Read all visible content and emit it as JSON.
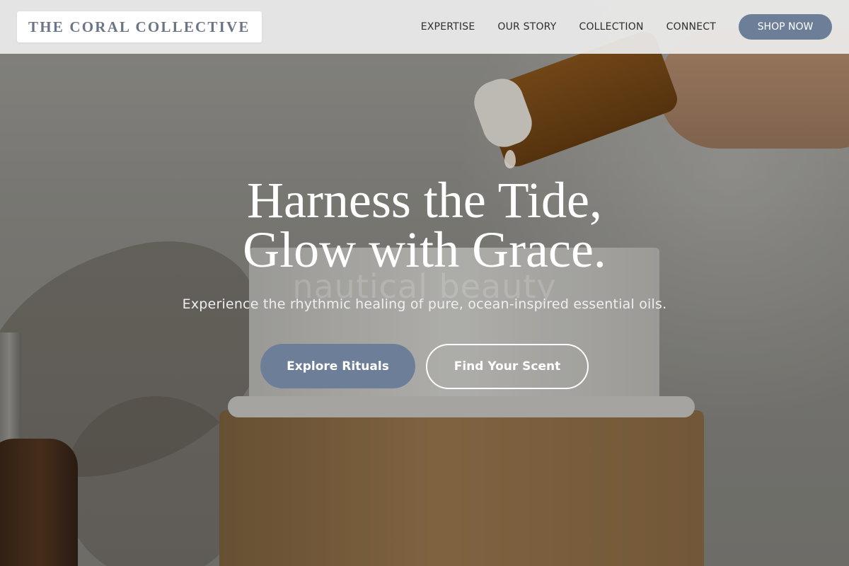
{
  "header": {
    "logo": "THE CORAL COLLECTIVE",
    "nav": [
      "EXPERTISE",
      "OUR STORY",
      "COLLECTION",
      "CONNECT"
    ],
    "cta": "SHOP NOW"
  },
  "hero": {
    "headline_line1": "Harness the Tide,",
    "headline_line2": "Glow with Grace.",
    "ghost_text": "nautical beauty",
    "subtitle": "Experience the rhythmic healing of pure, ocean-inspired essential oils.",
    "primary_button": "Explore Rituals",
    "secondary_button": "Find Your Scent"
  },
  "colors": {
    "accent": "#6d7f98",
    "header_bg": "#ececec",
    "logo_text": "#6a7585"
  }
}
